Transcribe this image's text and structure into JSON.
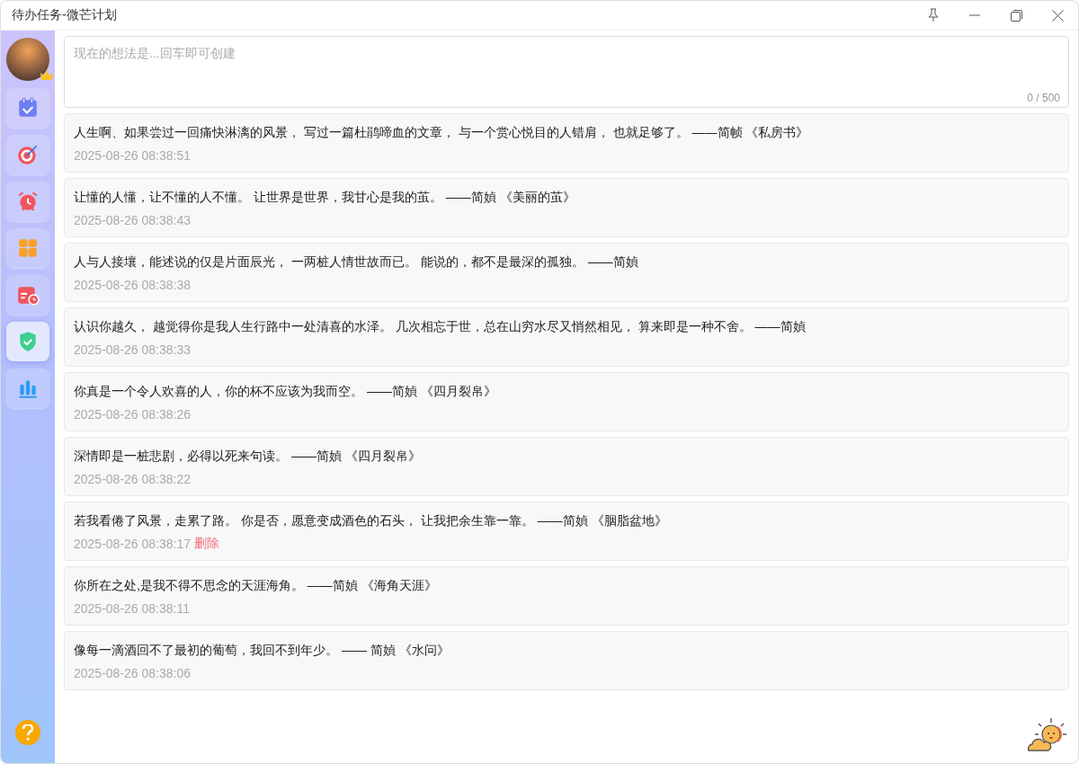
{
  "window": {
    "title": "待办任务-微芒计划"
  },
  "sidebar": {
    "items": [
      {
        "kind": "calendar-check",
        "selected": false
      },
      {
        "kind": "target",
        "selected": false
      },
      {
        "kind": "alarm",
        "selected": false
      },
      {
        "kind": "grid",
        "selected": false
      },
      {
        "kind": "calendar-clock",
        "selected": false
      },
      {
        "kind": "shield",
        "selected": true
      },
      {
        "kind": "bars",
        "selected": false
      }
    ]
  },
  "composer": {
    "placeholder": "现在的想法是...回车即可创建",
    "counter": "0 / 500"
  },
  "notes": [
    {
      "text": "人生啊、如果尝过一回痛快淋漓的风景， 写过一篇杜鹃啼血的文章， 与一个赏心悦目的人错肩， 也就足够了。 ——简帧 《私房书》",
      "time": "2025-08-26 08:38:51"
    },
    {
      "text": "让懂的人懂，让不懂的人不懂。 让世界是世界，我甘心是我的茧。 ——简媜 《美丽的茧》",
      "time": "2025-08-26 08:38:43"
    },
    {
      "text": "人与人接壤，能述说的仅是片面辰光， 一两桩人情世故而已。 能说的，都不是最深的孤独。 ——简媜",
      "time": "2025-08-26 08:38:38"
    },
    {
      "text": "认识你越久， 越觉得你是我人生行路中一处清喜的水泽。 几次相忘于世，总在山穷水尽又悄然相见， 算来即是一种不舍。 ——简媜",
      "time": "2025-08-26 08:38:33"
    },
    {
      "text": "你真是一个令人欢喜的人，你的杯不应该为我而空。 ——简媜 《四月裂帛》",
      "time": "2025-08-26 08:38:26"
    },
    {
      "text": "深情即是一桩悲剧，必得以死来句读。 ——简媜 《四月裂帛》",
      "time": "2025-08-26 08:38:22"
    },
    {
      "text": "若我看倦了风景，走累了路。 你是否，愿意变成酒色的石头， 让我把余生靠一靠。 ——简媜 《胭脂盆地》",
      "time": "2025-08-26 08:38:17",
      "action": "删除"
    },
    {
      "text": "你所在之处,是我不得不思念的天涯海角。 ——简媜 《海角天涯》",
      "time": "2025-08-26 08:38:11"
    },
    {
      "text": "像每一滴酒回不了最初的葡萄，我回不到年少。 —— 简媜 《水问》",
      "time": "2025-08-26 08:38:06"
    }
  ]
}
